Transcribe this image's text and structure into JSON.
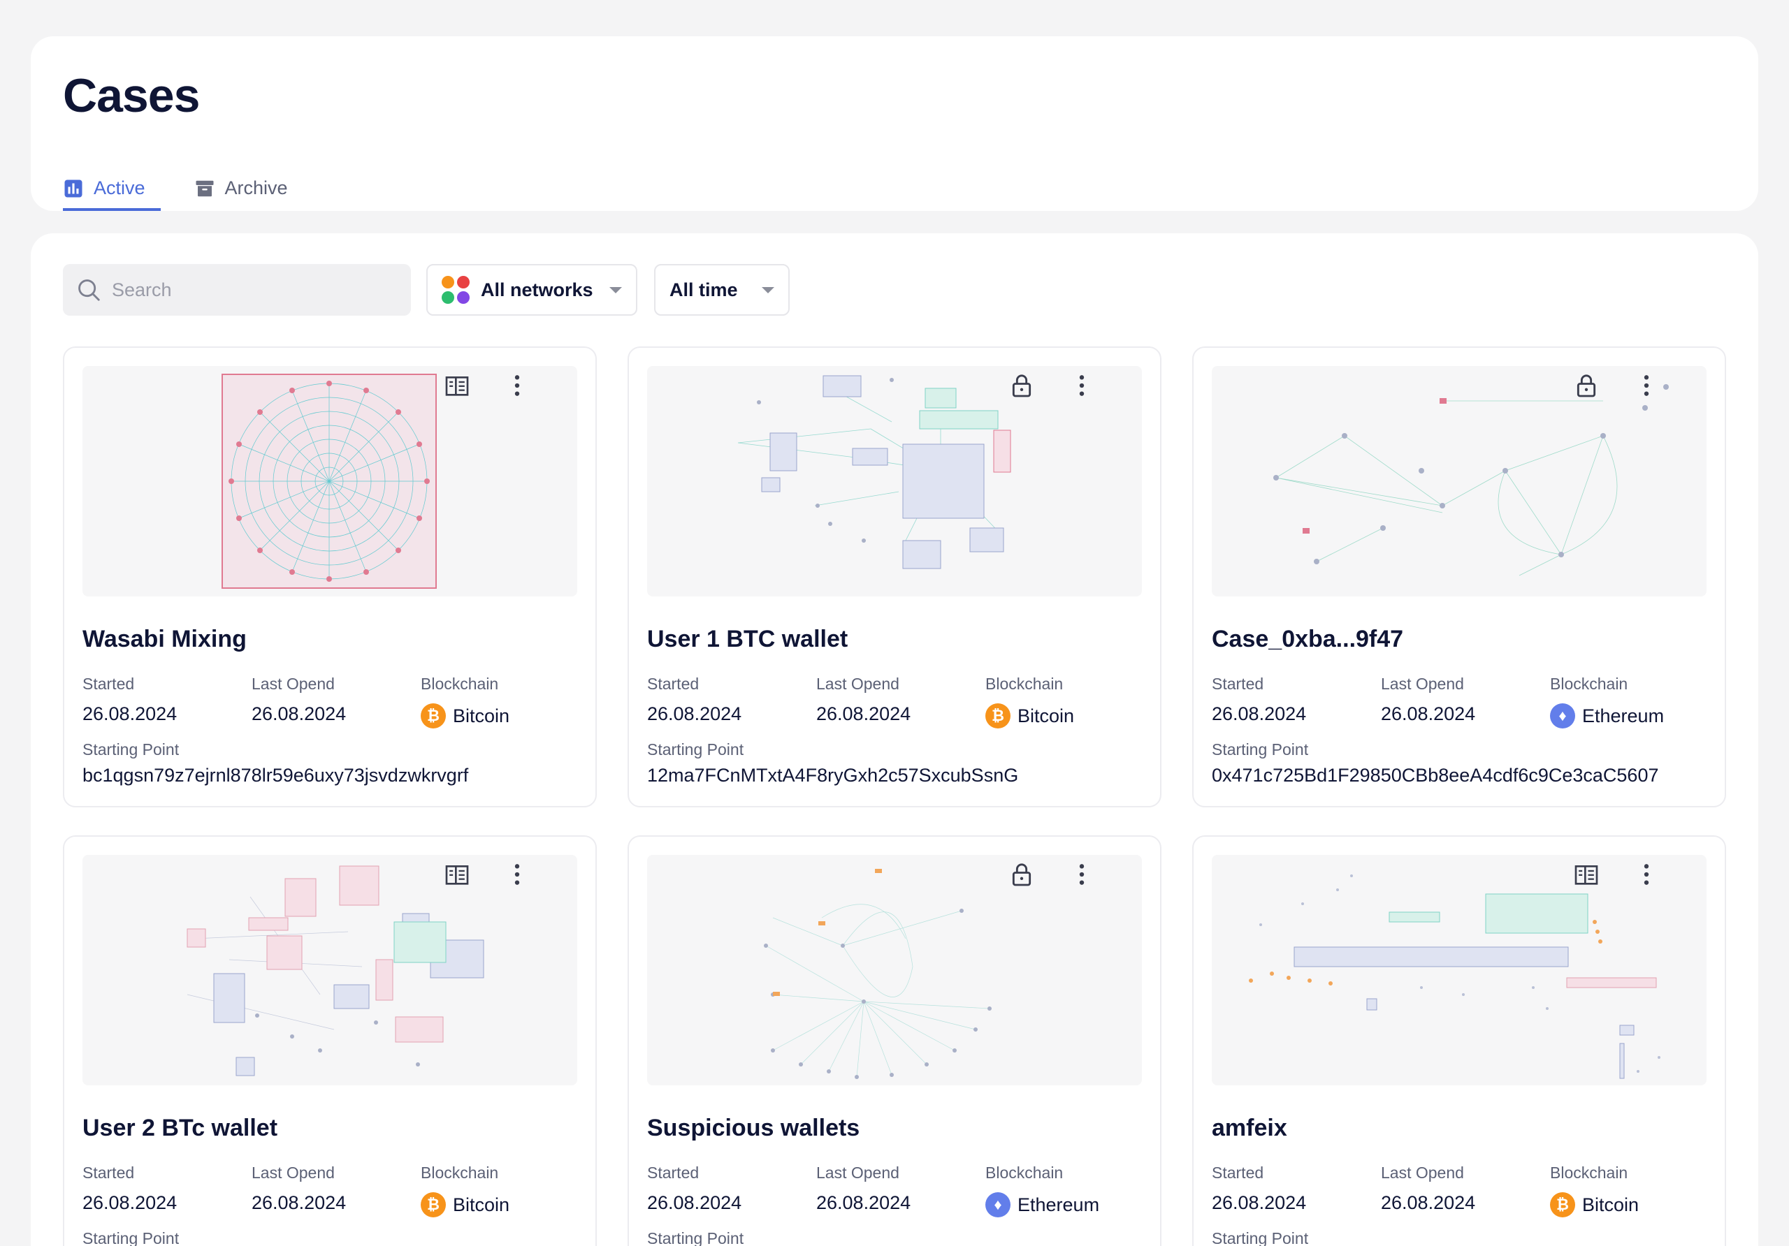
{
  "header": {
    "title": "Cases",
    "tabs": [
      {
        "label": "Active",
        "active": true
      },
      {
        "label": "Archive",
        "active": false
      }
    ]
  },
  "filters": {
    "search_placeholder": "Search",
    "networks_label": "All networks",
    "time_label": "All time"
  },
  "labels": {
    "started": "Started",
    "last_opened": "Last Opend",
    "blockchain": "Blockchain",
    "starting_point": "Starting Point"
  },
  "cases": [
    {
      "title": "Wasabi Mixing",
      "started": "26.08.2024",
      "last_opened": "26.08.2024",
      "blockchain": "Bitcoin",
      "starting_point": "bc1qgsn79z7ejrnl878lr59e6uxy73jsvdzwkrvgrf",
      "access_icon": "building-icon"
    },
    {
      "title": "User 1 BTC wallet",
      "started": "26.08.2024",
      "last_opened": "26.08.2024",
      "blockchain": "Bitcoin",
      "starting_point": "12ma7FCnMTxtA4F8ryGxh2c57SxcubSsnG",
      "access_icon": "lock-icon"
    },
    {
      "title": "Case_0xba...9f47",
      "started": "26.08.2024",
      "last_opened": "26.08.2024",
      "blockchain": "Ethereum",
      "starting_point": "0x471c725Bd1F29850CBb8eeA4cdf6c9Ce3caC5607",
      "access_icon": "lock-icon"
    },
    {
      "title": "User 2 BTc wallet",
      "started": "26.08.2024",
      "last_opened": "26.08.2024",
      "blockchain": "Bitcoin",
      "starting_point": "",
      "access_icon": "building-icon"
    },
    {
      "title": "Suspicious wallets",
      "started": "26.08.2024",
      "last_opened": "26.08.2024",
      "blockchain": "Ethereum",
      "starting_point": "",
      "access_icon": "lock-icon"
    },
    {
      "title": "amfeix",
      "started": "26.08.2024",
      "last_opened": "26.08.2024",
      "blockchain": "Bitcoin",
      "starting_point": "",
      "access_icon": "building-icon"
    }
  ],
  "colors": {
    "accent": "#4a6bd8",
    "bitcoin": "#f7931a",
    "ethereum": "#627eea"
  }
}
